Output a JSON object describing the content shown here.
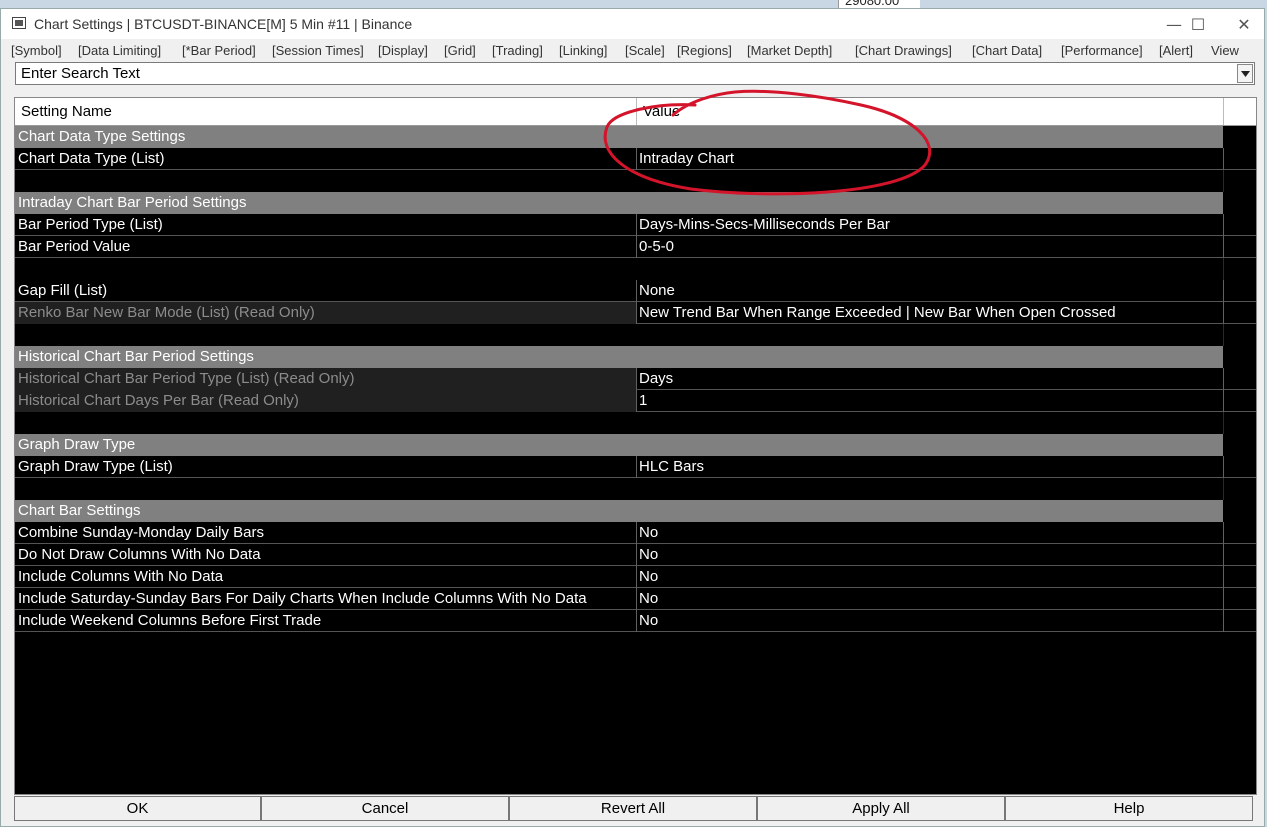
{
  "background": {
    "behind_text": "29080.00"
  },
  "window": {
    "title": "Chart Settings | BTCUSDT-BINANCE[M]  5 Min  #11 | Binance",
    "controls": {
      "minimize": "—",
      "maximize": "☐",
      "close": "✕"
    }
  },
  "menu": [
    "[Symbol]",
    "[Data Limiting]",
    "[*Bar Period]",
    "[Session Times]",
    "[Display]",
    "[Grid]",
    "[Trading]",
    "[Linking]",
    "[Scale]",
    "[Regions]",
    "[Market Depth]",
    "[Chart Drawings]",
    "[Chart Data]",
    "[Performance]",
    "[Alert]",
    "View"
  ],
  "search": {
    "placeholder": "Enter Search Text"
  },
  "columns": {
    "name": "Setting Name",
    "value": "Value"
  },
  "rows": [
    {
      "type": "section",
      "name": "Chart Data Type Settings"
    },
    {
      "type": "setting",
      "name": "Chart Data Type (List)",
      "value": "Intraday Chart"
    },
    {
      "type": "blank"
    },
    {
      "type": "section",
      "name": "Intraday Chart Bar Period Settings"
    },
    {
      "type": "setting",
      "name": "Bar Period Type (List)",
      "value": "Days-Mins-Secs-Milliseconds Per Bar"
    },
    {
      "type": "setting",
      "name": "Bar Period Value",
      "value": "0-5-0"
    },
    {
      "type": "blank"
    },
    {
      "type": "setting",
      "name": "Gap Fill (List)",
      "value": "None"
    },
    {
      "type": "setting",
      "name": "Renko Bar New Bar Mode (List) (Read Only)",
      "value": "New Trend Bar When Range Exceeded | New Bar When Open Crossed",
      "readonly": true
    },
    {
      "type": "blank"
    },
    {
      "type": "section",
      "name": "Historical Chart Bar Period Settings"
    },
    {
      "type": "setting",
      "name": "Historical Chart Bar Period Type (List) (Read Only)",
      "value": "Days",
      "readonly": true
    },
    {
      "type": "setting",
      "name": "Historical Chart Days Per Bar (Read Only)",
      "value": "1",
      "readonly": true
    },
    {
      "type": "blank"
    },
    {
      "type": "section",
      "name": "Graph Draw Type"
    },
    {
      "type": "setting",
      "name": "Graph Draw Type (List)",
      "value": "HLC Bars"
    },
    {
      "type": "blank"
    },
    {
      "type": "section",
      "name": "Chart Bar Settings"
    },
    {
      "type": "setting",
      "name": "Combine Sunday-Monday Daily Bars",
      "value": "No"
    },
    {
      "type": "setting",
      "name": "Do Not Draw Columns With No Data",
      "value": "No"
    },
    {
      "type": "setting",
      "name": "Include Columns With No Data",
      "value": "No"
    },
    {
      "type": "setting",
      "name": "Include Saturday-Sunday Bars For Daily Charts When Include Columns With No Data",
      "value": "No"
    },
    {
      "type": "setting",
      "name": "Include Weekend Columns Before First Trade",
      "value": "No"
    }
  ],
  "buttons": {
    "ok": "OK",
    "cancel": "Cancel",
    "revert": "Revert All",
    "apply": "Apply All",
    "help": "Help"
  },
  "colors": {
    "annotation": "#d4142a",
    "section_bg": "#808080",
    "grid_bg": "#000000"
  }
}
